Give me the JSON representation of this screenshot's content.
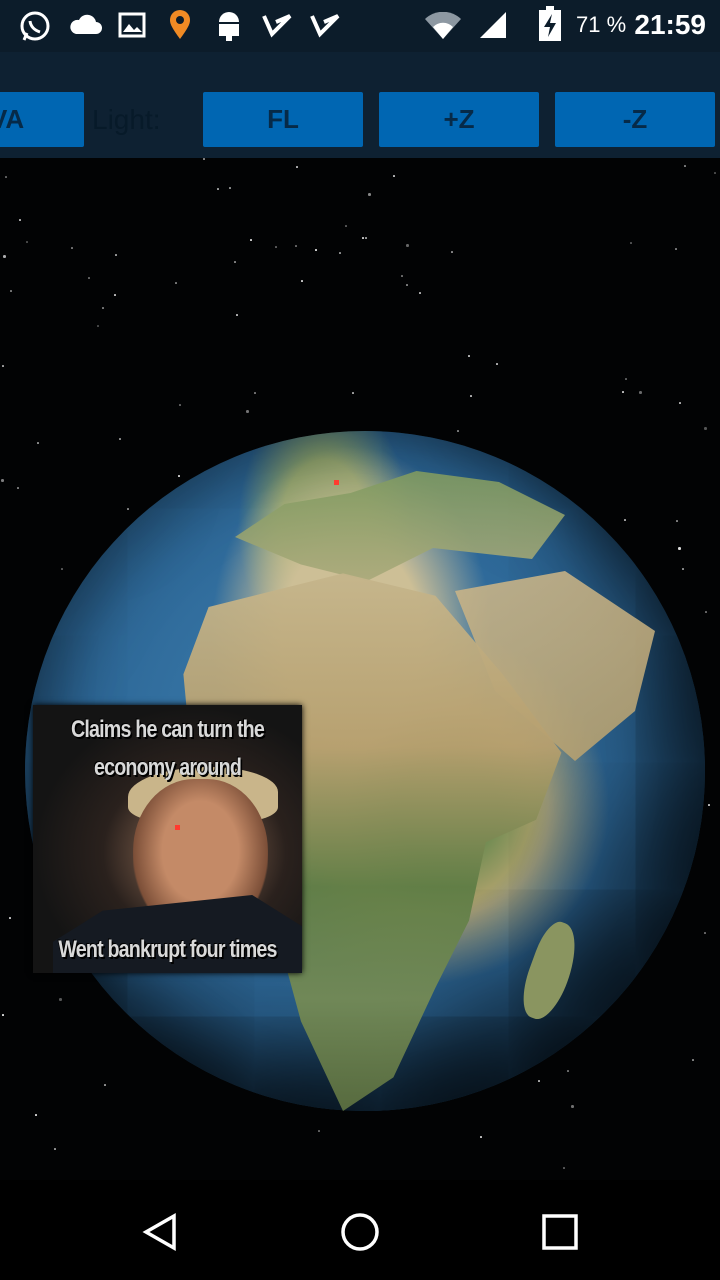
{
  "status_bar": {
    "battery_percent": "71 %",
    "time": "21:59",
    "icons": [
      "whatsapp-icon",
      "cloud-icon",
      "image-icon",
      "location-pin-icon",
      "android-icon",
      "check-tick-icon",
      "check-tick-icon",
      "wifi-icon",
      "signal-icon",
      "battery-charging-icon"
    ]
  },
  "toolbar": {
    "partial_button_label": "VA",
    "light_label": "Light:",
    "buttons": [
      {
        "label": "FL"
      },
      {
        "label": "+Z"
      },
      {
        "label": "-Z"
      }
    ]
  },
  "meme": {
    "top_text": "Claims he can turn the economy around",
    "bottom_text": "Went bankrupt four times"
  },
  "nav_bar": {
    "icons": [
      "back-triangle-icon",
      "home-circle-icon",
      "recents-square-icon"
    ]
  },
  "colors": {
    "toolbar_bg": "#0e2132",
    "button_bg": "#0066b2",
    "status_bg": "#0c1c2a"
  }
}
